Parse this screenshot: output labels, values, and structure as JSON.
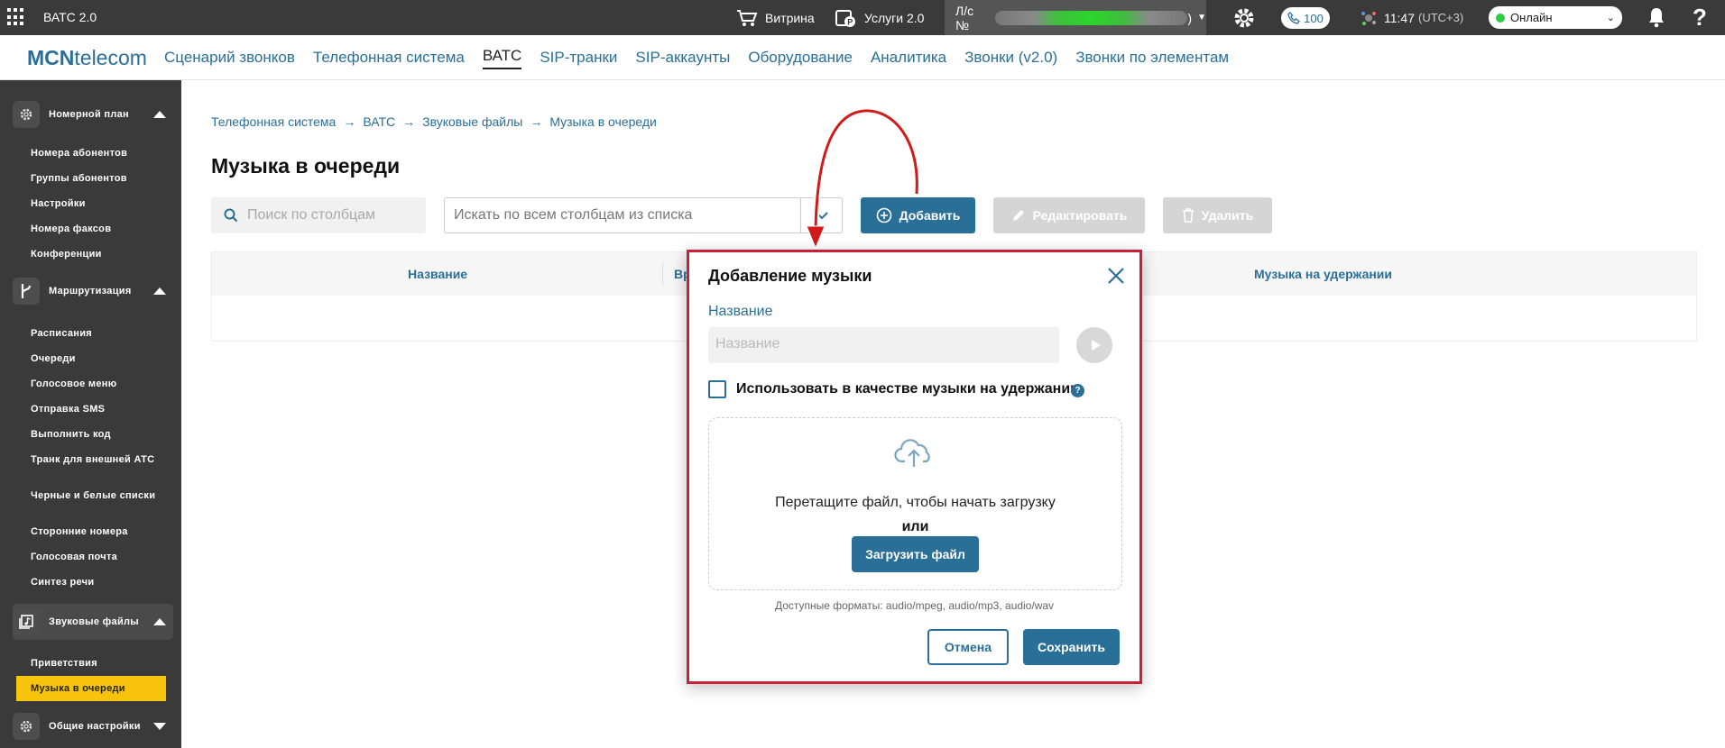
{
  "topbar": {
    "app_title": "ВАТС 2.0",
    "showcase": "Витрина",
    "services": "Услуги 2.0",
    "account_prefix": "Л/с №",
    "account_suffix": ")",
    "calls_count": "100",
    "time": "11:47",
    "timezone": "(UTC+3)",
    "status": "Онлайн"
  },
  "logo": {
    "bold": "MCN",
    "rest": "telecom"
  },
  "nav": [
    {
      "label": "Сценарий звонков",
      "active": false
    },
    {
      "label": "Телефонная система",
      "active": false
    },
    {
      "label": "ВАТС",
      "active": true
    },
    {
      "label": "SIP-транки",
      "active": false
    },
    {
      "label": "SIP-аккаунты",
      "active": false
    },
    {
      "label": "Оборудование",
      "active": false
    },
    {
      "label": "Аналитика",
      "active": false
    },
    {
      "label": "Звонки (v2.0)",
      "active": false
    },
    {
      "label": "Звонки по элементам",
      "active": false
    }
  ],
  "sidebar": {
    "sections": [
      {
        "label": "Номерной план",
        "icon": "gear-icon"
      },
      {
        "label": "Маршрутизация",
        "icon": "branch-icon"
      },
      {
        "label": "Звуковые файлы",
        "icon": "music-file-icon"
      },
      {
        "label": "Общие настройки",
        "icon": "gear-icon"
      }
    ],
    "numbering_items": [
      "Номера абонентов",
      "Группы абонентов",
      "Настройки",
      "Номера факсов",
      "Конференции"
    ],
    "routing_items": [
      "Расписания",
      "Очереди",
      "Голосовое меню",
      "Отправка SMS",
      "Выполнить код",
      "Транк для внешней АТС",
      "Черные и белые списки",
      "Сторонние номера",
      "Голосовая почта",
      "Синтез речи"
    ],
    "sound_items": [
      "Приветствия",
      "Музыка в очереди"
    ]
  },
  "breadcrumb": [
    "Телефонная система",
    "ВАТС",
    "Звуковые файлы",
    "Музыка в очереди"
  ],
  "page_title": "Музыка в очереди",
  "toolbar": {
    "search_placeholder": "Поиск по столбцам",
    "filter_placeholder": "Искать по всем столбцам из списка",
    "add": "Добавить",
    "edit": "Редактировать",
    "delete": "Удалить"
  },
  "table": {
    "columns": [
      "Название",
      "Вр",
      "Музыка на удержании"
    ]
  },
  "modal": {
    "title": "Добавление музыки",
    "name_label": "Название",
    "name_placeholder": "Название",
    "checkbox_label": "Использовать в качестве музыки на удержании",
    "help": "?",
    "drop_text": "Перетащите файл, чтобы начать загрузку",
    "or": "или",
    "upload": "Загрузить файл",
    "formats": "Доступные форматы: audio/mpeg, audio/mp3, audio/wav",
    "cancel": "Отмена",
    "save": "Сохранить"
  },
  "colors": {
    "accent": "#2a6f97",
    "highlight": "#f7c30c",
    "annotation": "#c8213a",
    "topbar": "#3a3a3a"
  }
}
